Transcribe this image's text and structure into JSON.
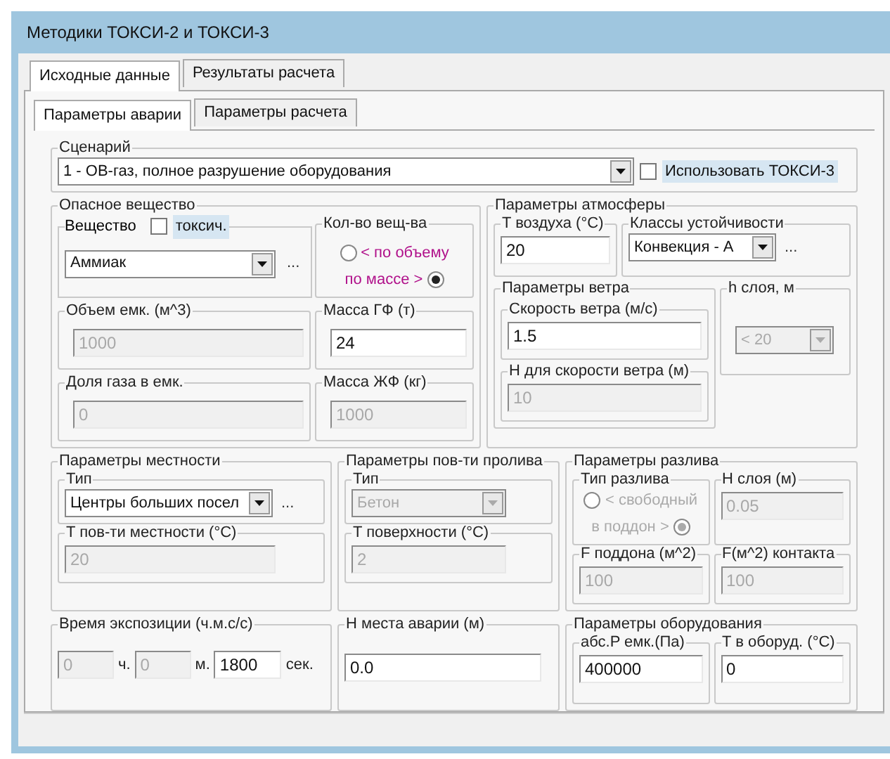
{
  "window": {
    "title": "Методики ТОКСИ-2 и ТОКСИ-3"
  },
  "tabs": [
    {
      "label": "Исходные данные",
      "selected": true
    },
    {
      "label": "Результаты расчета",
      "selected": false
    }
  ],
  "subtabs": [
    {
      "label": "Параметры аварии",
      "selected": true
    },
    {
      "label": "Параметры расчета",
      "selected": false
    }
  ],
  "scenario": {
    "label": "Сценарий",
    "value": "1 - ОВ-газ, полное разрушение оборудования",
    "use_toxi3": {
      "label": "Использовать ТОКСИ-3",
      "checked": false
    }
  },
  "hazardous_substance": {
    "title": "Опасное вещество",
    "substance": {
      "label": "Вещество",
      "toxic": {
        "label": "токсич.",
        "checked": false
      },
      "value": "Аммиак",
      "more": "..."
    },
    "quantity": {
      "label": "Кол-во вещ-ва",
      "options": [
        {
          "label": "< по объему",
          "selected": false
        },
        {
          "label": "по массе >",
          "selected": true
        }
      ]
    },
    "fields": [
      {
        "label": "Объем емк. (м^3)",
        "value": "1000",
        "disabled": true
      },
      {
        "label": "Масса ГФ (т)",
        "value": "24",
        "disabled": false
      },
      {
        "label": "Доля газа в емк.",
        "value": "0",
        "disabled": true
      },
      {
        "label": "Масса ЖФ (кг)",
        "value": "1000",
        "disabled": true
      }
    ]
  },
  "atmosphere": {
    "title": "Параметры атмосферы",
    "air_temp": {
      "label": "T воздуха (°C)",
      "value": "20",
      "disabled": false
    },
    "stability": {
      "label": "Классы устойчивости",
      "value": "Конвекция - А",
      "more": "..."
    },
    "wind": {
      "title": "Параметры ветра",
      "fields": [
        {
          "label": "Скорость ветра (м/с)",
          "value": "1.5",
          "disabled": false
        },
        {
          "label": "H для скорости ветра (м)",
          "value": "10",
          "disabled": true
        }
      ]
    },
    "layer": {
      "label": "h слоя, м",
      "value": "< 20",
      "disabled": true
    }
  },
  "terrain": {
    "title": "Параметры местности",
    "type": {
      "label": "Тип",
      "value": "Центры больших посел",
      "disabled": false,
      "more": "..."
    },
    "temp": {
      "label": "T пов-ти местности (°C)",
      "value": "20",
      "disabled": true
    }
  },
  "spill_surface": {
    "title": "Параметры пов-ти пролива",
    "type": {
      "label": "Тип",
      "value": "Бетон",
      "disabled": true
    },
    "temp": {
      "label": "T поверхности (°C)",
      "value": "2",
      "disabled": true
    }
  },
  "spill": {
    "title": "Параметры разлива",
    "type": {
      "label": "Тип разлива",
      "disabled": true,
      "options": [
        {
          "label": "< свободный",
          "selected": false
        },
        {
          "label": "в поддон >",
          "selected": true
        }
      ]
    },
    "fields": [
      {
        "label": "H слоя (м)",
        "value": "0.05",
        "disabled": true
      },
      {
        "label": "F поддона (м^2)",
        "value": "100",
        "disabled": true
      },
      {
        "label": "F(м^2) контакта",
        "value": "100",
        "disabled": true
      }
    ]
  },
  "exposure": {
    "title": "Время экспозиции (ч.м.с/с)",
    "parts": [
      {
        "value": "0",
        "unit": "ч.",
        "disabled": true
      },
      {
        "value": "0",
        "unit": "м.",
        "disabled": true
      },
      {
        "value": "1800",
        "unit": "сек.",
        "disabled": false
      }
    ]
  },
  "accident_height": {
    "label": "H места аварии (м)",
    "value": "0.0",
    "disabled": false
  },
  "equipment": {
    "title": "Параметры оборудования",
    "fields": [
      {
        "label": "абс.P емк.(Па)",
        "value": "400000",
        "disabled": false
      },
      {
        "label": "T в оборуд. (°C)",
        "value": "0",
        "disabled": false
      }
    ]
  }
}
